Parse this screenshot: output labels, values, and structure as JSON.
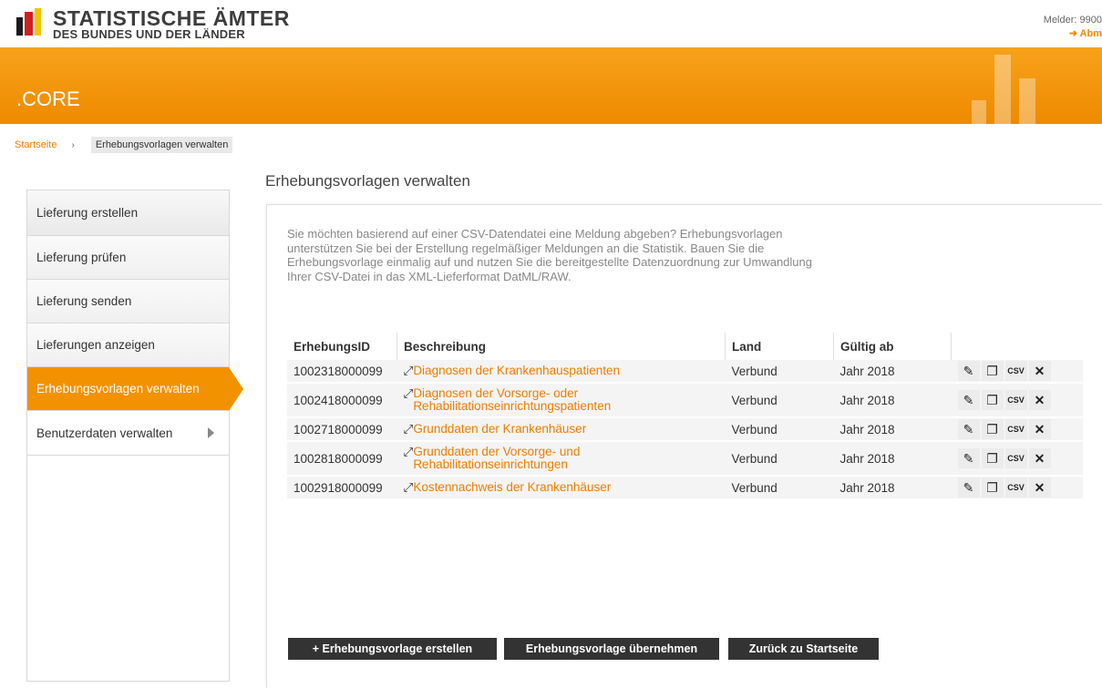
{
  "header": {
    "logo_line1": "STATISTISCHE ÄMTER",
    "logo_line2": "DES BUNDES UND DER LÄNDER",
    "melder": "Melder: 9900",
    "logout": "➜ Abm"
  },
  "banner": {
    "title": ".CORE"
  },
  "breadcrumb": {
    "home": "Startseite",
    "separator": "›",
    "current": "Erhebungsvorlagen verwalten"
  },
  "sidebar": {
    "items": [
      {
        "label": "Lieferung erstellen"
      },
      {
        "label": "Lieferung prüfen"
      },
      {
        "label": "Lieferung senden"
      },
      {
        "label": "Lieferungen anzeigen"
      },
      {
        "label": "Erhebungsvorlagen verwalten"
      },
      {
        "label": "Benutzerdaten verwalten"
      }
    ]
  },
  "main": {
    "title": "Erhebungsvorlagen verwalten",
    "intro": "Sie möchten basierend auf einer CSV-Datendatei eine Meldung abgeben? Erhebungsvorlagen unterstützen Sie bei der Erstellung regelmäßiger Meldungen an die Statistik. Bauen Sie die Erhebungsvorlage einmalig auf und nutzen Sie die bereitgestellte Datenzuordnung zur Umwandlung Ihrer CSV-Datei in das XML-Lieferformat DatML/RAW.",
    "table": {
      "headers": [
        "ErhebungsID",
        "Beschreibung",
        "Land",
        "Gültig ab"
      ],
      "rows": [
        {
          "id": "1002318000099",
          "desc": "Diagnosen der Krankenhauspatienten",
          "land": "Verbund",
          "gueltig": "Jahr 2018"
        },
        {
          "id": "1002418000099",
          "desc": "Diagnosen der Vorsorge- oder Rehabilitationseinrichtungspatienten",
          "land": "Verbund",
          "gueltig": "Jahr 2018"
        },
        {
          "id": "1002718000099",
          "desc": "Grunddaten der Krankenhäuser",
          "land": "Verbund",
          "gueltig": "Jahr 2018"
        },
        {
          "id": "1002818000099",
          "desc": "Grunddaten der Vorsorge- und Rehabilitationseinrichtungen",
          "land": "Verbund",
          "gueltig": "Jahr 2018"
        },
        {
          "id": "1002918000099",
          "desc": "Kostennachweis der Krankenhäuser",
          "land": "Verbund",
          "gueltig": "Jahr 2018"
        }
      ]
    },
    "icons": {
      "edit": "pencil-icon",
      "copy": "copy-icon",
      "csv": "csv-icon",
      "delete": "close-icon"
    },
    "buttons": {
      "create": "+ Erhebungsvorlage erstellen",
      "import": "Erhebungsvorlage übernehmen",
      "back": "Zurück zu Startseite"
    }
  },
  "colors": {
    "accent": "#f39200",
    "link": "#ee7d00",
    "button": "#333333"
  }
}
